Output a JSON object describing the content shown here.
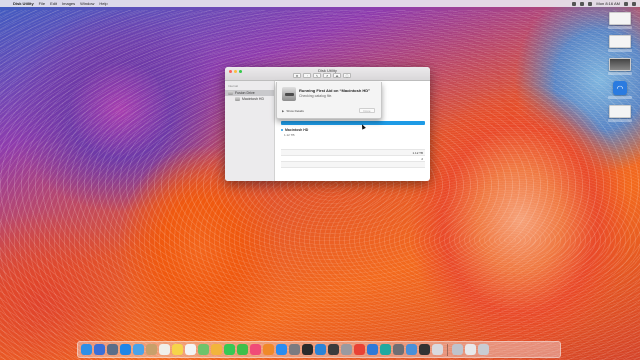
{
  "menubar": {
    "app_name": "Disk Utility",
    "menus": [
      "File",
      "Edit",
      "Images",
      "Window",
      "Help"
    ],
    "clock": "Mon 8:16 AM"
  },
  "window": {
    "title": "Disk Utility",
    "sidebar": {
      "section": "Internal",
      "items": [
        {
          "label": "Fusion Drive",
          "selected": true
        },
        {
          "label": "Macintosh HD",
          "selected": false
        }
      ]
    },
    "volume": {
      "name": "Macintosh HD",
      "size": "1.12 TB",
      "bar_color": "#1e9be6"
    },
    "info_rows": [
      {
        "left_value": "",
        "right_label": "",
        "right_value": "1.12 TB"
      },
      {
        "left_value": "",
        "right_label": "",
        "right_value": "2"
      },
      {
        "left_value": "",
        "right_label": "",
        "right_value": ""
      },
      {
        "left_value": "",
        "right_label": "",
        "right_value": ""
      }
    ]
  },
  "sheet": {
    "title": "Running First Aid on “Macintosh HD”",
    "status": "Checking catalog file.",
    "details_label": "Show Details",
    "done_label": "Done"
  },
  "desktop": {
    "icons": [
      {
        "name": "screenshot",
        "kind": "thumb"
      },
      {
        "name": "screenshot",
        "kind": "thumb"
      },
      {
        "name": "screenshot",
        "kind": "dark"
      },
      {
        "name": "wifi",
        "kind": "wifi"
      },
      {
        "name": "screenshot",
        "kind": "thumb"
      }
    ]
  },
  "dock": {
    "apps": [
      {
        "name": "finder",
        "color": "#2f8fe6"
      },
      {
        "name": "safari-compass",
        "color": "#3a6fd8"
      },
      {
        "name": "launchpad-rocket",
        "color": "#5b6e89"
      },
      {
        "name": "safari",
        "color": "#1f86e8"
      },
      {
        "name": "mail",
        "color": "#4aa3e9"
      },
      {
        "name": "contacts",
        "color": "#c8a06a"
      },
      {
        "name": "calendar",
        "color": "#f0efe9"
      },
      {
        "name": "notes",
        "color": "#f6d44a"
      },
      {
        "name": "reminders",
        "color": "#f4f4f4"
      },
      {
        "name": "maps",
        "color": "#6fc36b"
      },
      {
        "name": "photos",
        "color": "#f2b53c"
      },
      {
        "name": "messages",
        "color": "#37c855"
      },
      {
        "name": "facetime",
        "color": "#3fbf4a"
      },
      {
        "name": "itunes",
        "color": "#f04b78"
      },
      {
        "name": "ibooks",
        "color": "#f0892a"
      },
      {
        "name": "app-store",
        "color": "#2a8cf0"
      },
      {
        "name": "system-preferences",
        "color": "#7b7b80"
      },
      {
        "name": "activity-monitor",
        "color": "#2b2b2b"
      },
      {
        "name": "wifi-app",
        "color": "#2b83d6"
      },
      {
        "name": "terminal",
        "color": "#3c3c3c"
      },
      {
        "name": "disk-utility",
        "color": "#9a9aa0"
      },
      {
        "name": "chrome",
        "color": "#e94235"
      },
      {
        "name": "app-blue",
        "color": "#2f79d8"
      },
      {
        "name": "app-teal",
        "color": "#1fa9a0"
      },
      {
        "name": "app-gray",
        "color": "#6e6e73"
      },
      {
        "name": "preview",
        "color": "#4a90d9"
      },
      {
        "name": "app-dark",
        "color": "#333333"
      },
      {
        "name": "app-light",
        "color": "#d9d9de"
      }
    ],
    "trailing": [
      {
        "name": "downloads-stack",
        "color": "#bfc3cc"
      },
      {
        "name": "document-stack",
        "color": "#e8e8ea"
      },
      {
        "name": "trash",
        "color": "#c9ccd2"
      }
    ]
  }
}
